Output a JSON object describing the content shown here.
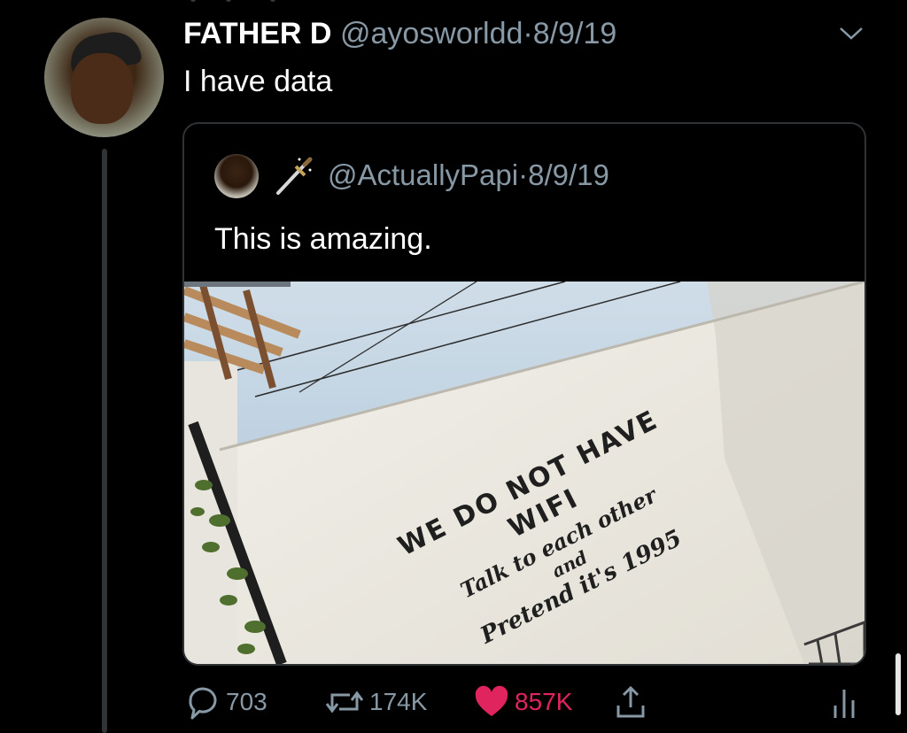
{
  "tweet": {
    "author_name": "FATHER D",
    "meta": "@ayosworldd·8/9/19",
    "text": "I have data"
  },
  "quoted": {
    "meta": "@ActuallyPapi·8/9/19",
    "text": "This is amazing.",
    "image": {
      "type": "photo",
      "wall_text": [
        "WE DO NOT HAVE",
        "WIFI",
        "Talk to each other",
        "and",
        "Pretend it's 1995"
      ]
    }
  },
  "actions": {
    "replies": "703",
    "retweets": "174K",
    "likes": "857K"
  },
  "colors": {
    "background": "#000000",
    "muted_text": "#8899a6",
    "like_red": "#e0245e",
    "border": "#2f3336"
  },
  "icons": [
    "reply-icon",
    "retweet-icon",
    "heart-icon",
    "share-icon",
    "analytics-icon",
    "chevron-down-icon",
    "dagger-icon"
  ]
}
